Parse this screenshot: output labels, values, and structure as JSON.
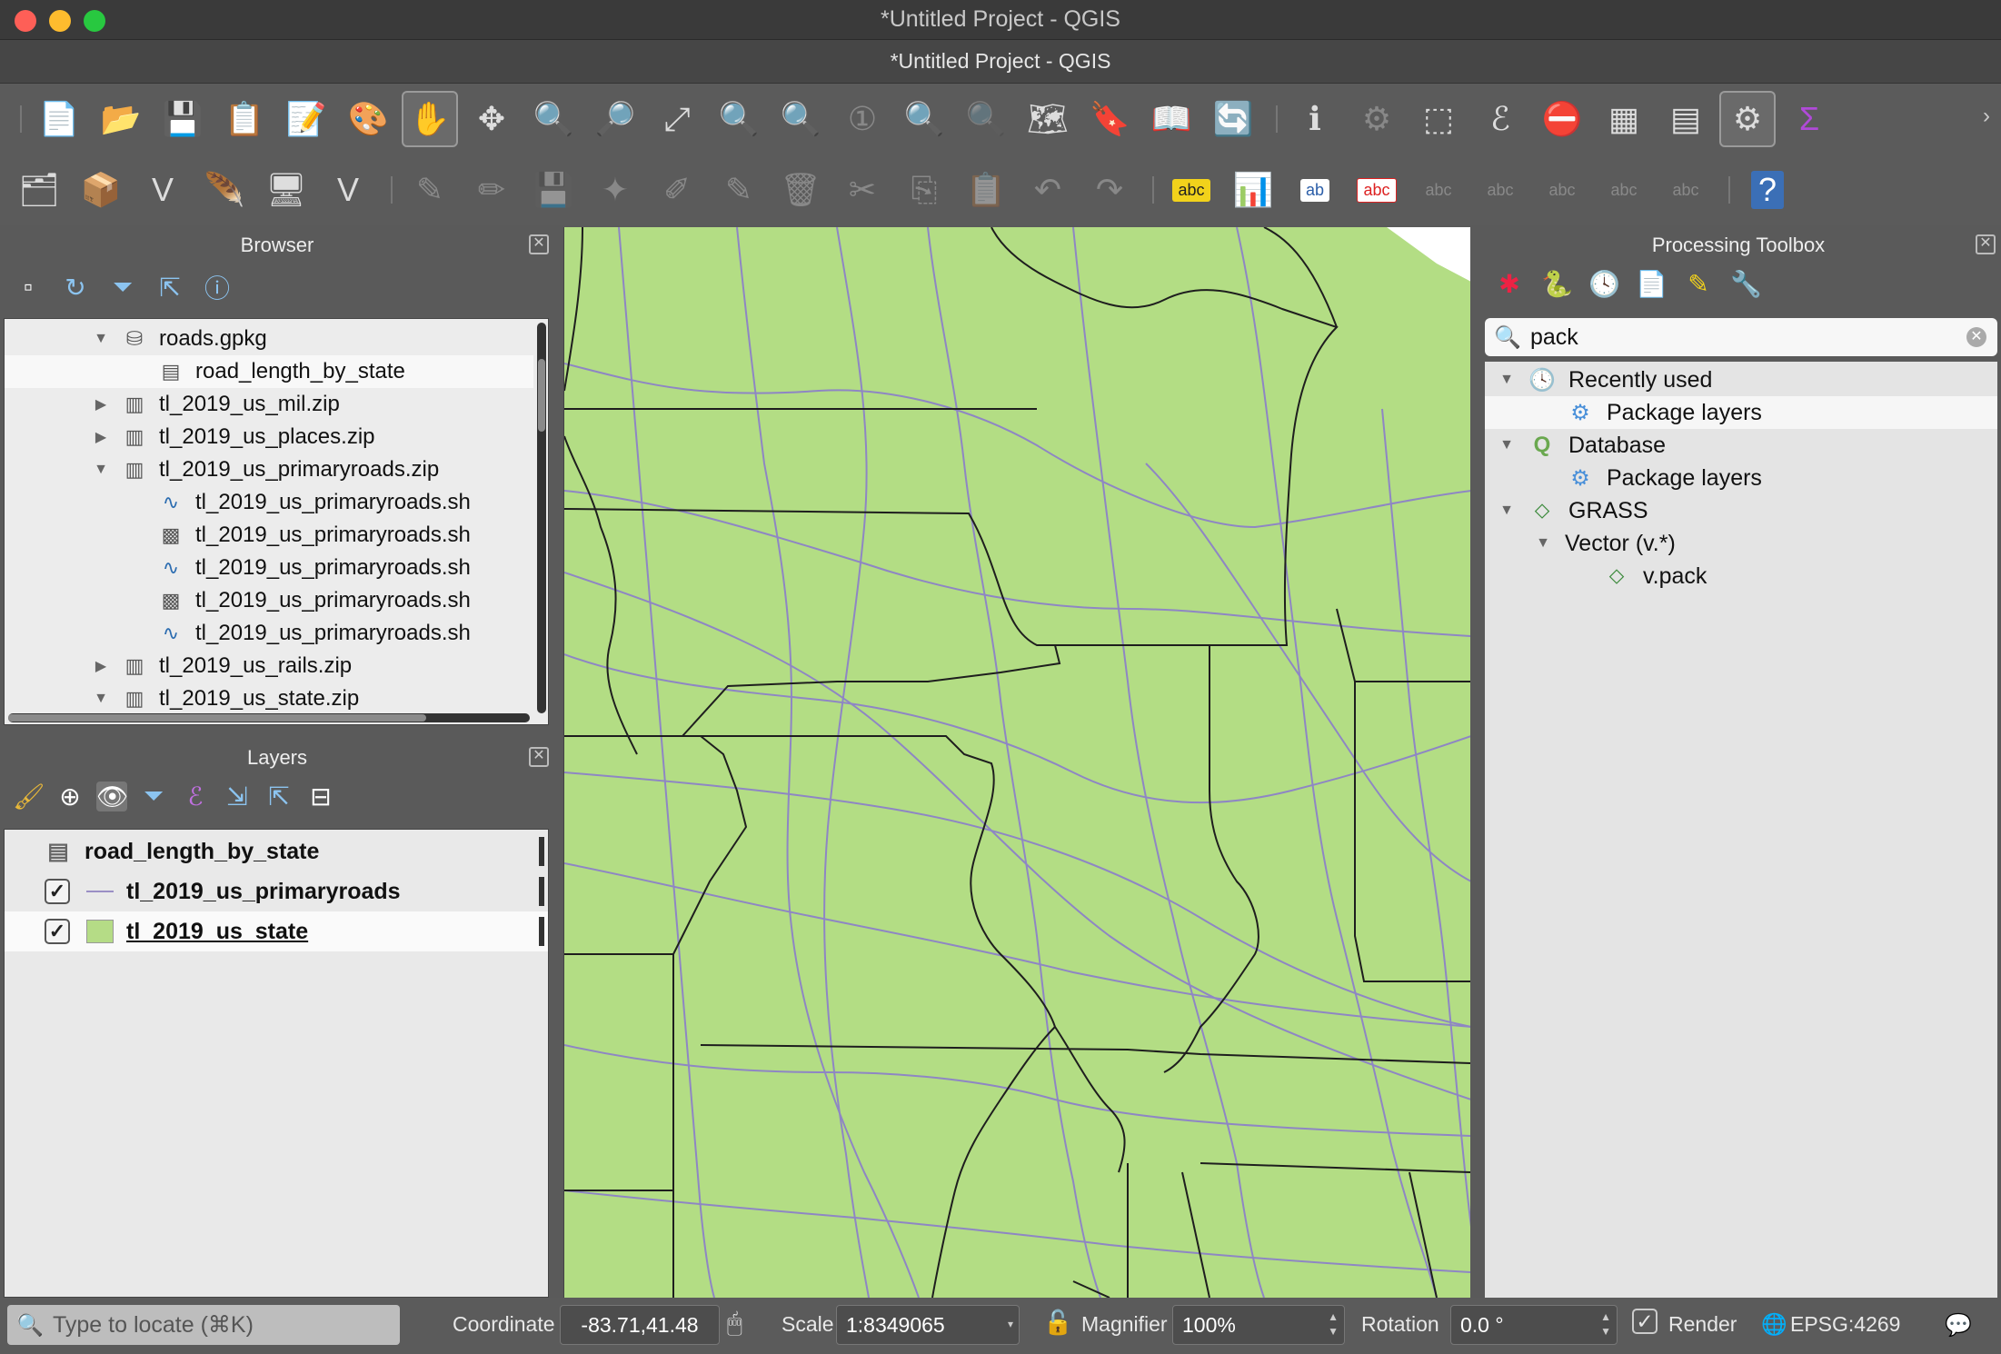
{
  "window": {
    "title": "*Untitled Project - QGIS",
    "subtitle": "*Untitled Project - QGIS"
  },
  "browser": {
    "title": "Browser",
    "items": [
      {
        "label": "roads.gpkg",
        "arrow": "▼",
        "icon": "database-icon"
      },
      {
        "label": "road_length_by_state",
        "arrow": "",
        "icon": "table-icon"
      },
      {
        "label": "tl_2019_us_mil.zip",
        "arrow": "▶",
        "icon": "zip-icon"
      },
      {
        "label": "tl_2019_us_places.zip",
        "arrow": "▶",
        "icon": "zip-icon"
      },
      {
        "label": "tl_2019_us_primaryroads.zip",
        "arrow": "▼",
        "icon": "zip-icon"
      },
      {
        "label": "tl_2019_us_primaryroads.sh",
        "arrow": "",
        "icon": "line-layer-icon"
      },
      {
        "label": "tl_2019_us_primaryroads.sh",
        "arrow": "",
        "icon": "raster-icon"
      },
      {
        "label": "tl_2019_us_primaryroads.sh",
        "arrow": "",
        "icon": "line-layer-icon"
      },
      {
        "label": "tl_2019_us_primaryroads.sh",
        "arrow": "",
        "icon": "raster-icon"
      },
      {
        "label": "tl_2019_us_primaryroads.sh",
        "arrow": "",
        "icon": "line-layer-icon"
      },
      {
        "label": "tl_2019_us_rails.zip",
        "arrow": "▶",
        "icon": "zip-icon"
      },
      {
        "label": "tl_2019_us_state.zip",
        "arrow": "▼",
        "icon": "zip-icon"
      }
    ]
  },
  "layers": {
    "title": "Layers",
    "items": [
      {
        "label": "road_length_by_state",
        "checked": null,
        "symbol": "table"
      },
      {
        "label": "tl_2019_us_primaryroads",
        "checked": true,
        "symbol": "line"
      },
      {
        "label": "tl_2019_us_state",
        "checked": true,
        "symbol": "fill"
      }
    ]
  },
  "toolbox": {
    "title": "Processing Toolbox",
    "search_value": "pack",
    "items": [
      {
        "label": "Recently used",
        "arrow": "▼",
        "icon": "clock-icon"
      },
      {
        "label": "Package layers",
        "arrow": "",
        "icon": "gear-icon"
      },
      {
        "label": "Database",
        "arrow": "▼",
        "icon": "qgis-icon"
      },
      {
        "label": "Package layers",
        "arrow": "",
        "icon": "gear-icon"
      },
      {
        "label": "GRASS",
        "arrow": "▼",
        "icon": "grass-icon"
      },
      {
        "label": "Vector (v.*)",
        "arrow": "▼",
        "icon": ""
      },
      {
        "label": "v.pack",
        "arrow": "",
        "icon": "grass-icon"
      }
    ]
  },
  "statusbar": {
    "locate_placeholder": "Type to locate (⌘K)",
    "coordinate_label": "Coordinate",
    "coordinate_value": "-83.71,41.48",
    "scale_label": "Scale",
    "scale_value": "1:8349065",
    "magnifier_label": "Magnifier",
    "magnifier_value": "100%",
    "rotation_label": "Rotation",
    "rotation_value": "0.0 °",
    "render_label": "Render",
    "crs": "EPSG:4269"
  },
  "colors": {
    "map_fill": "#b3dd84",
    "roads": "#8e86c4",
    "borders": "#222222"
  }
}
